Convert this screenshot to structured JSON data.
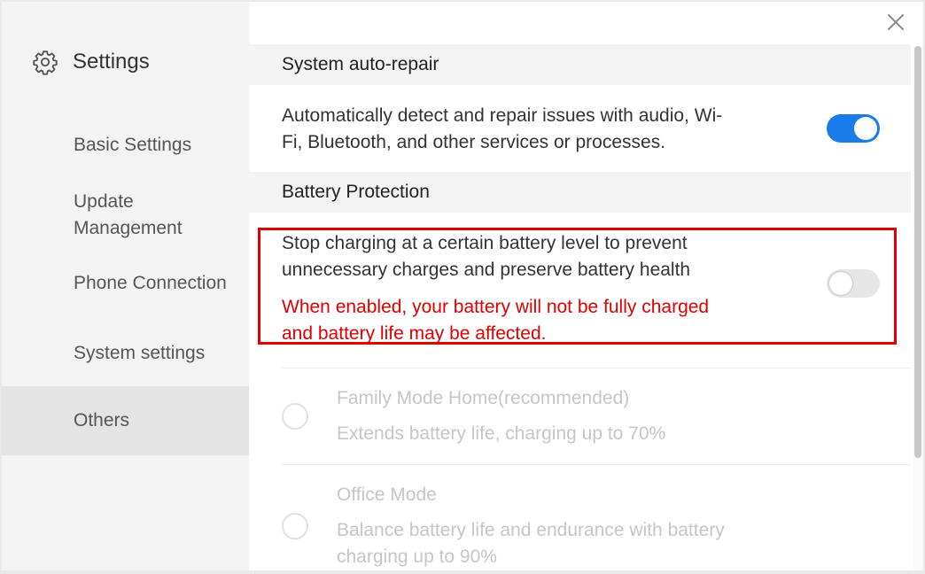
{
  "sidebar": {
    "title": "Settings",
    "items": [
      {
        "label": "Basic Settings"
      },
      {
        "label": "Update Management"
      },
      {
        "label": "Phone Connection"
      },
      {
        "label": "System settings"
      },
      {
        "label": "Others"
      }
    ],
    "active_item": "Others"
  },
  "sections": {
    "auto_repair": {
      "header": "System auto-repair",
      "description_lines": [
        "Automatically detect and repair issues with audio, Wi-",
        "Fi, Bluetooth, and other services or processes."
      ],
      "toggle_on": true
    },
    "battery": {
      "header": "Battery Protection",
      "description_lines": [
        "Stop charging at a certain battery level to prevent",
        "unnecessary charges and preserve battery health"
      ],
      "warning_lines": [
        "When enabled, your battery will not be fully charged",
        "and battery life may be affected."
      ],
      "toggle_on": false,
      "options": [
        {
          "title": "Family Mode Home(recommended)",
          "description": "Extends battery life, charging up to 70%"
        },
        {
          "title": "Office Mode",
          "description_lines": [
            "Balance battery life and endurance with battery",
            "charging up to 90%"
          ]
        }
      ]
    }
  },
  "icons": {
    "settings": "gear-icon",
    "close": "close-icon"
  },
  "colors": {
    "accent": "#1a7bea",
    "warning": "#e00000",
    "sidebar_bg": "#f3f3f3",
    "disabled_text": "#c6c6c6"
  }
}
